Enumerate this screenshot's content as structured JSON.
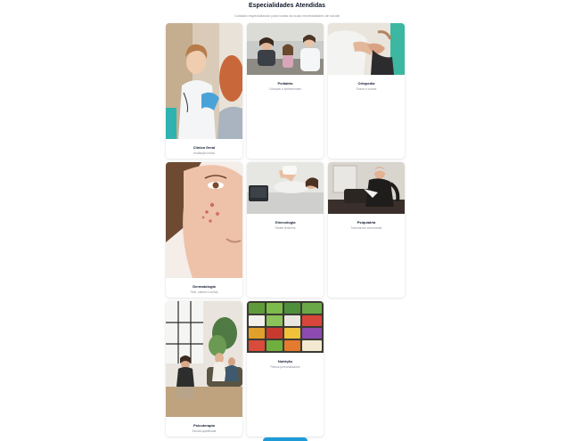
{
  "section": {
    "title": "Especialidades Atendidas",
    "subtitle": "Cuidado especializado para todas as suas necessidades de saúde"
  },
  "cards": [
    {
      "title": "Clínica Geral",
      "desc": "Avaliação inicial",
      "photo": "doctor-examining-patient-photo"
    },
    {
      "title": "Pediatria",
      "desc": "Crianças e adolescentes",
      "photo": "pediatric-consultation-photo"
    },
    {
      "title": "Ortopedia",
      "desc": "Ossos e coluna",
      "photo": "orthopedic-exam-photo"
    },
    {
      "title": "Dermatologia",
      "desc": "Pele, cabelo e unhas",
      "photo": "skin-closeup-photo"
    },
    {
      "title": "Ginecologia",
      "desc": "Saúde feminina",
      "photo": "ultrasound-exam-photo"
    },
    {
      "title": "Psiquiatria",
      "desc": "Transtornos emocionais",
      "photo": "therapy-session-photo"
    },
    {
      "title": "Psicoterapia",
      "desc": "Escuta qualificada",
      "photo": "group-therapy-room-photo"
    },
    {
      "title": "Nutrição",
      "desc": "Planos personalizados",
      "photo": "vegetables-market-photo"
    }
  ],
  "colors": {
    "accent": "#1e9bd7",
    "title": "#0f172a",
    "muted": "#8a8f98"
  }
}
